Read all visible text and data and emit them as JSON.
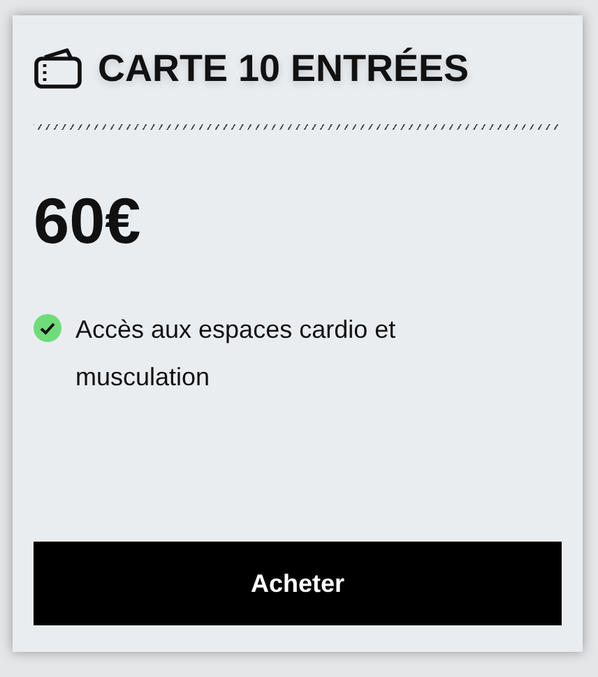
{
  "card": {
    "title": "CARTE 10 ENTRÉES",
    "price": "60€",
    "features": [
      {
        "text": "Accès aux espaces cardio et musculation",
        "included": true
      }
    ],
    "button": "Acheter"
  }
}
